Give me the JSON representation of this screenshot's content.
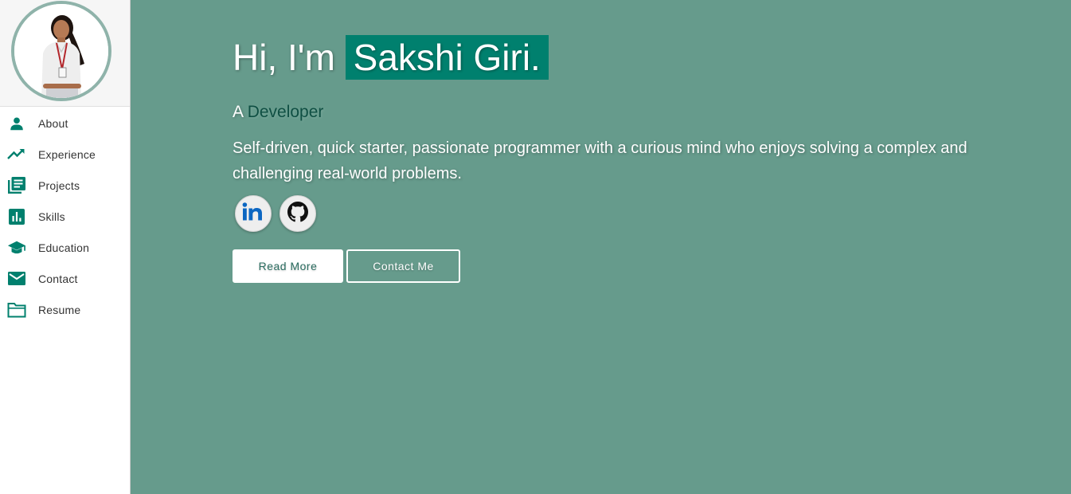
{
  "sidebar": {
    "avatar_alt": "Profile photo",
    "items": [
      {
        "label": "About",
        "icon": "person-icon"
      },
      {
        "label": "Experience",
        "icon": "trending-up-icon"
      },
      {
        "label": "Projects",
        "icon": "list-alt-icon"
      },
      {
        "label": "Skills",
        "icon": "bar-chart-icon"
      },
      {
        "label": "Education",
        "icon": "school-icon"
      },
      {
        "label": "Contact",
        "icon": "mail-icon"
      },
      {
        "label": "Resume",
        "icon": "folder-icon"
      }
    ]
  },
  "hero": {
    "greeting": "Hi, I'm ",
    "name": "Sakshi Giri.",
    "role_prefix": "A ",
    "role": "Developer",
    "tagline": "Self-driven, quick starter, passionate programmer with a curious mind who enjoys solving a complex and challenging real-world problems.",
    "social": [
      {
        "icon": "linkedin-icon"
      },
      {
        "icon": "github-icon"
      }
    ],
    "read_more_label": "Read More",
    "contact_label": "Contact Me"
  },
  "colors": {
    "accent": "#00806e",
    "main_background": "#669b8c",
    "icon_color": "#00806e"
  }
}
